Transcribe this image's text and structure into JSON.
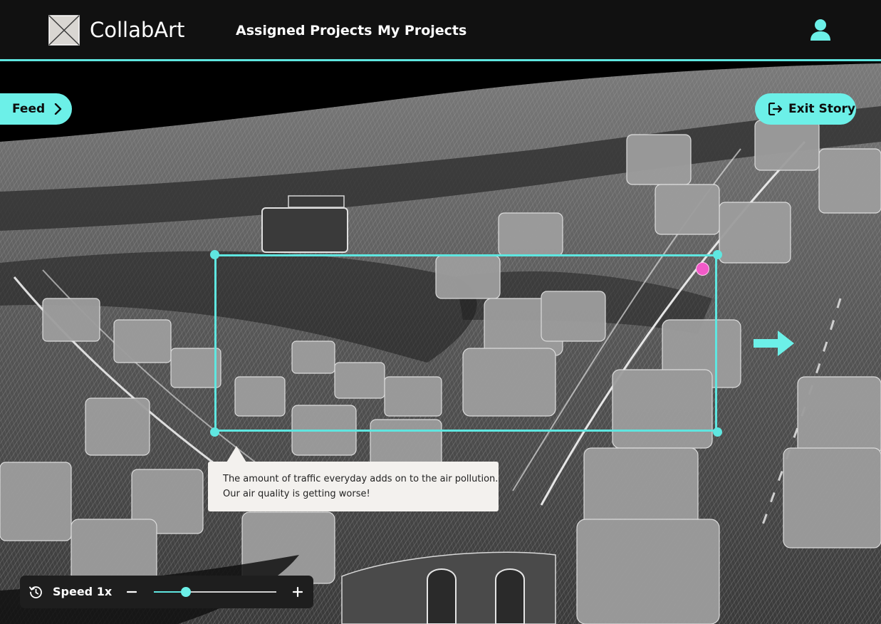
{
  "header": {
    "app_name": "CollabArt",
    "logo_icon": "placeholder-x-box-icon",
    "nav": [
      {
        "label": "Assigned Projects"
      },
      {
        "label": "My Projects"
      }
    ],
    "user_icon": "user-icon"
  },
  "story": {
    "feed_label": "Feed",
    "feed_icon": "chevron-right-icon",
    "exit_label": "Exit Story",
    "exit_icon": "exit-icon",
    "next_icon": "arrow-right-icon"
  },
  "comment": {
    "lines": [
      "The amount of traffic everyday adds on to the air pollution.",
      "Our air quality is getting worse!"
    ]
  },
  "playback": {
    "history_icon": "history-icon",
    "speed_label": "Speed 1x",
    "speed_level": 0.26,
    "minus_icon": "minus-icon",
    "plus_icon": "plus-icon"
  },
  "colors": {
    "accent": "#5fe6e0",
    "accent_light": "#6cf0e8",
    "topbar": "#111111",
    "pin": "#f25ac8",
    "bubble": "#f3f1ee"
  }
}
